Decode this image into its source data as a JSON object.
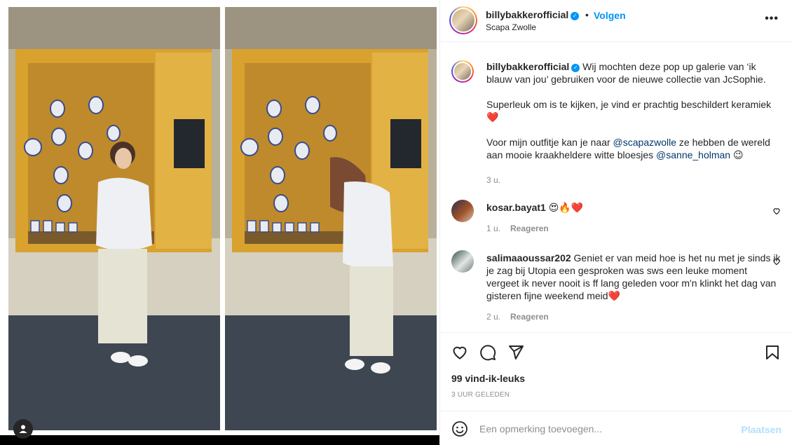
{
  "header": {
    "username": "billybakkerofficial",
    "verified_mark": "✓",
    "separator": "•",
    "follow_label": "Volgen",
    "location": "Scapa Zwolle",
    "more_label": "•••"
  },
  "caption": {
    "username": "billybakkerofficial",
    "para1": "Wij mochten deze pop up galerie van ‘ik blauw van jou’ gebruiken voor de nieuwe collectie van JcSophie.",
    "para2": "Superleuk om is te kijken, je vind er prachtig beschildert keramiek❤️",
    "para3_a": "Voor mijn outfitje kan je naar ",
    "para3_mention1": "@scapazwolle",
    "para3_b": " ze hebben de wereld aan mooie kraakheldere witte bloesjes ",
    "para3_mention2": "@sanne_holman",
    "para3_c": " 😉",
    "time": "3 u."
  },
  "comments": [
    {
      "username": "kosar.bayat1",
      "text": "😍🔥❤️",
      "time": "1 u.",
      "reply_label": "Reageren"
    },
    {
      "username": "salimaaoussar202",
      "text": "Geniet er van meid hoe is het nu met je sinds ik je zag bij Utopia een gesproken was sws een leuke moment vergeet ik never nooit is ff lang geleden voor m'n klinkt het dag van gisteren fijne weekend meid❤️",
      "time": "2 u.",
      "reply_label": "Reageren"
    }
  ],
  "actions": {
    "likes": "99 vind-ik-leuks",
    "posted": "3 UUR GELEDEN",
    "icons": [
      "heart-icon",
      "comment-icon",
      "share-icon",
      "bookmark-icon"
    ]
  },
  "composer": {
    "placeholder": "Een opmerking toevoegen...",
    "post_label": "Plaatsen"
  },
  "colors": {
    "accent": "#0095f6",
    "link": "#00376b",
    "muted": "#8e8e8e",
    "post_disabled": "#b2dffc"
  }
}
